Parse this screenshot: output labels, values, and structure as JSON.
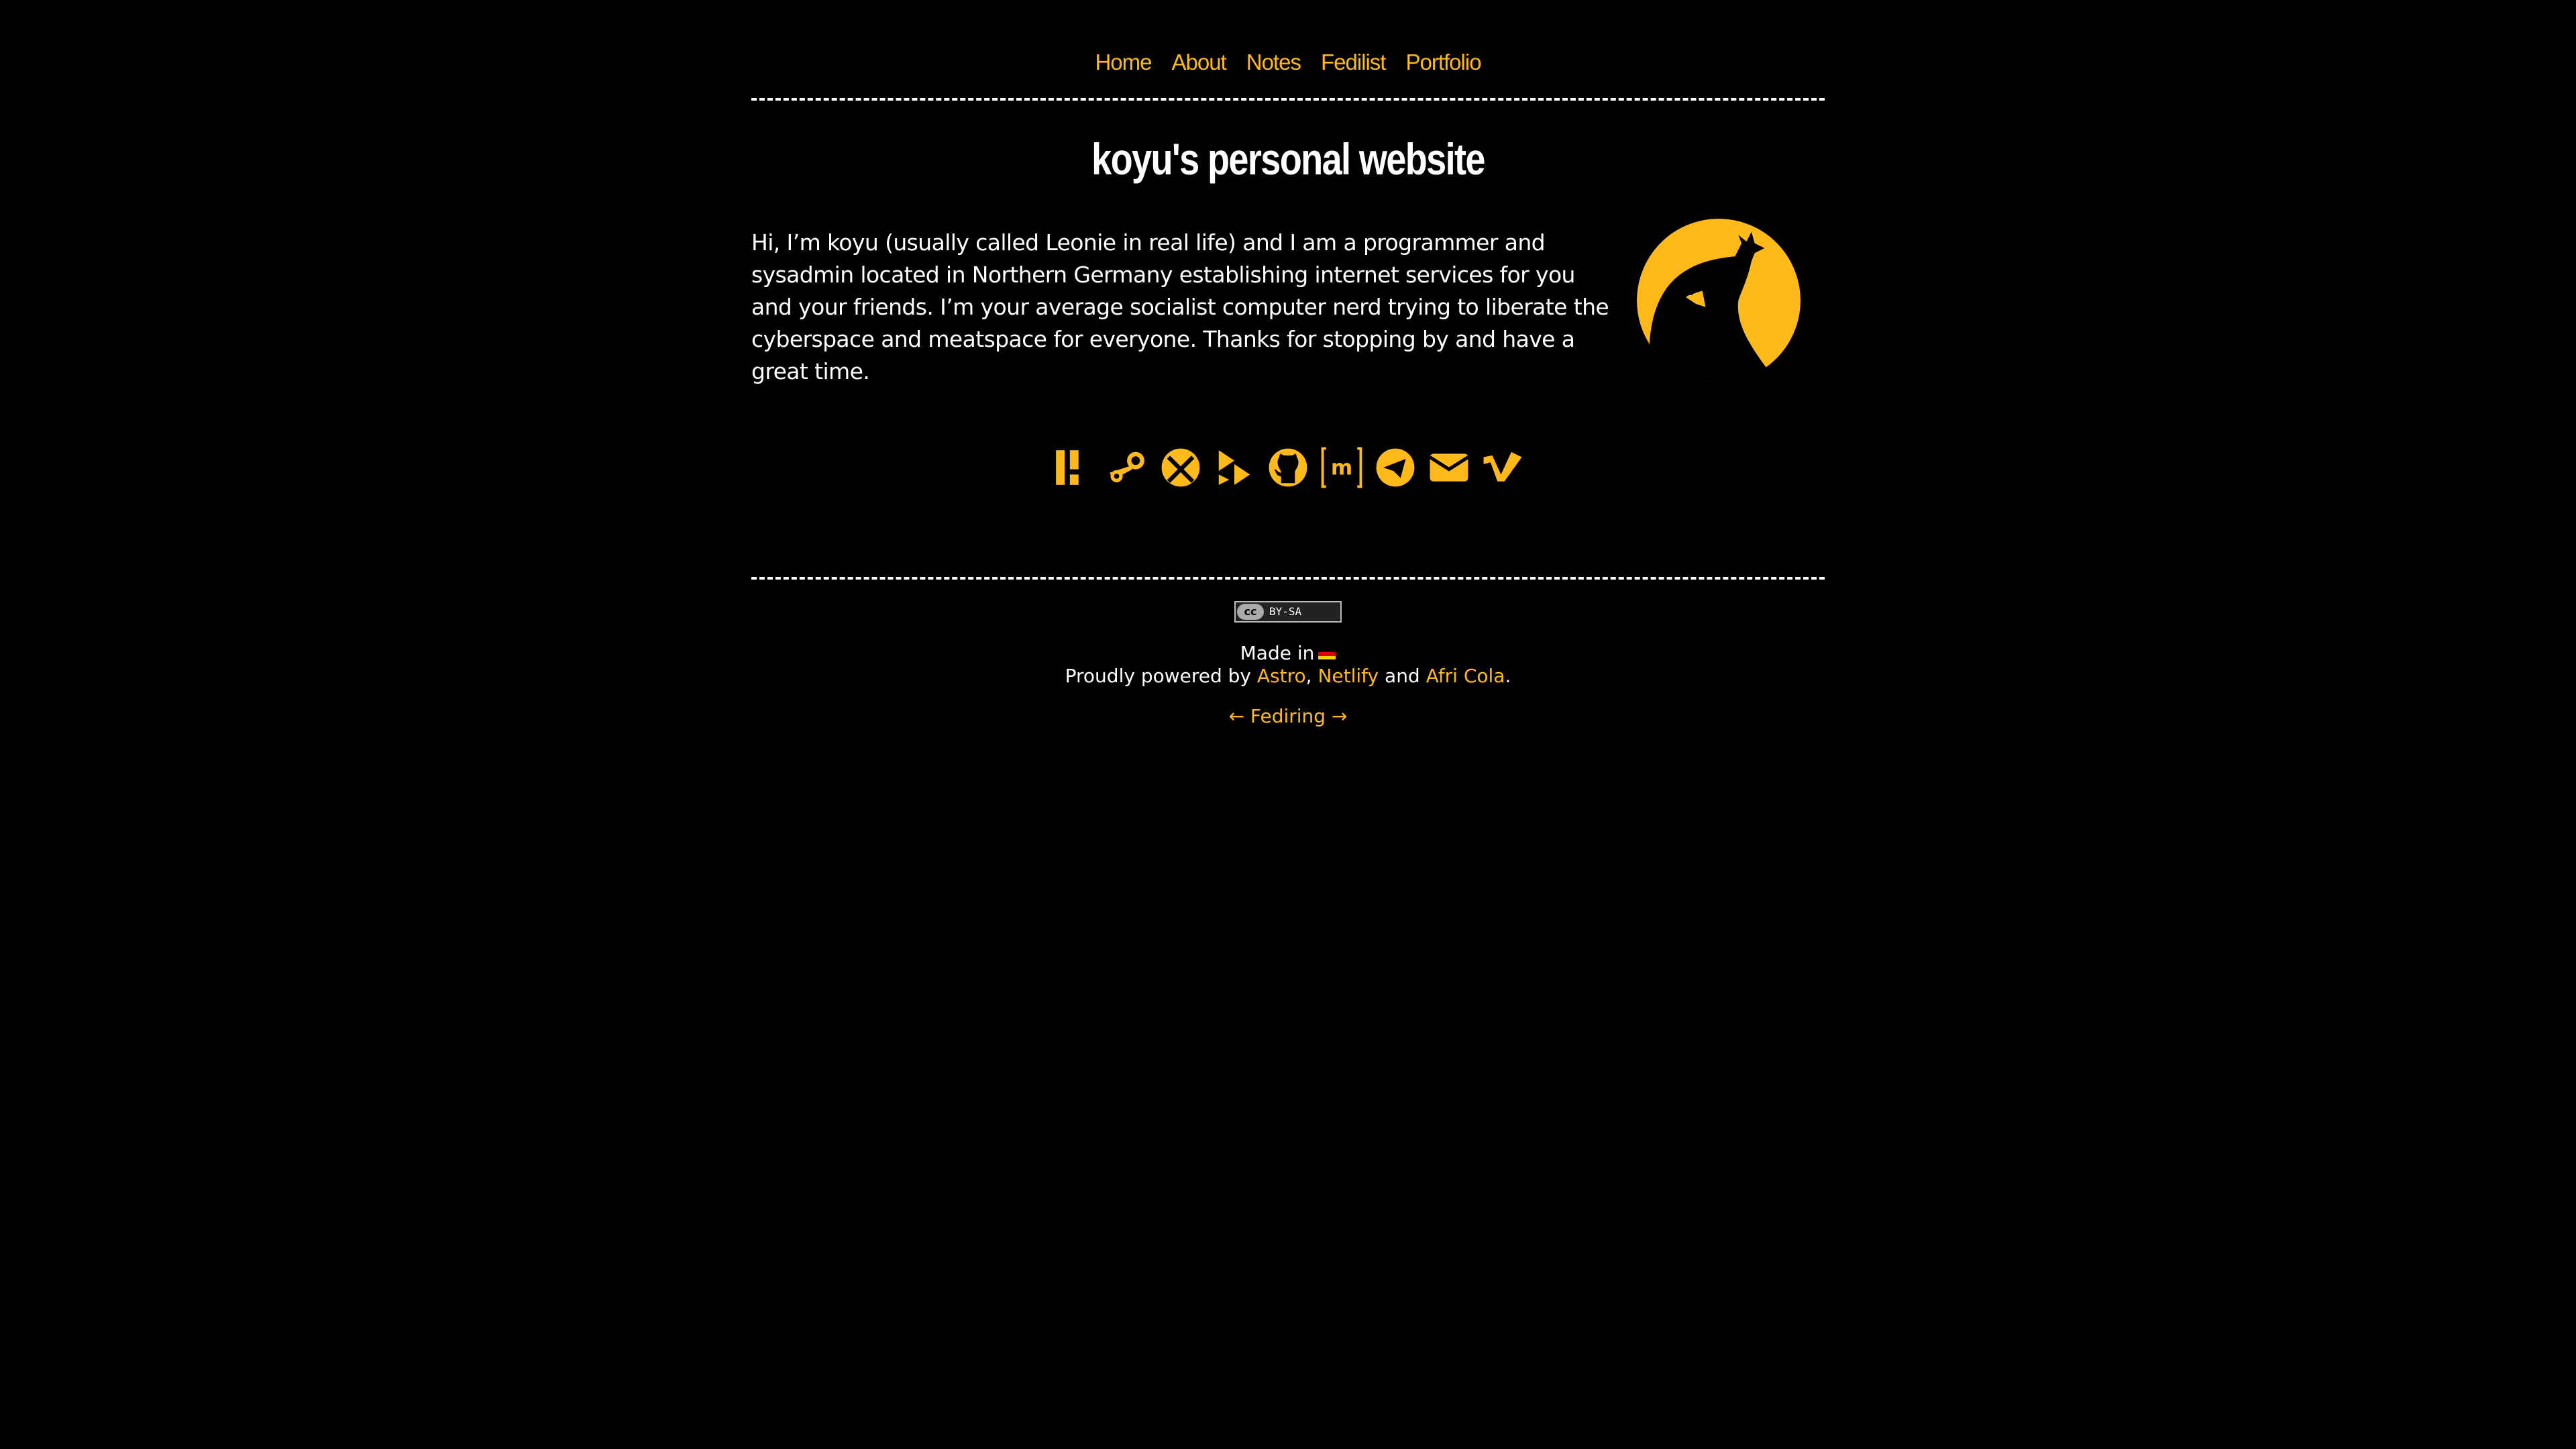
{
  "nav": {
    "items": [
      {
        "label": "Home"
      },
      {
        "label": "About"
      },
      {
        "label": "Notes"
      },
      {
        "label": "Fedilist"
      },
      {
        "label": "Portfolio"
      }
    ]
  },
  "page": {
    "title": "koyu's personal website",
    "intro": "Hi, I’m koyu (usually called Leonie in real life) and I am a programmer and sysadmin located in Northern Germany establishing internet services for you and your friends. I’m your average socialist computer nerd trying to liberate the cyberspace and meatspace for everyone. Thanks for stopping by and have a great time.",
    "avatar_icon": "silhouette-avatar-icon"
  },
  "social_icons": [
    "patreon-icon",
    "steam-icon",
    "xbox-icon",
    "playstore-icon",
    "github-icon",
    "matrix-icon",
    "telegram-icon",
    "email-icon",
    "vimeo-icon"
  ],
  "footer": {
    "badge_cc": "cc",
    "badge_license": "BY-SA",
    "made_in": "Made in",
    "powered_prefix": "Proudly powered by",
    "astro": "Astro",
    "netlify": "Netlify",
    "and": "and",
    "afri_cola": "Afri Cola",
    "period": ".",
    "fediring": "← Fediring →"
  },
  "colors": {
    "accent": "#ffba1a",
    "background": "#000000",
    "text": "#ffffff"
  }
}
